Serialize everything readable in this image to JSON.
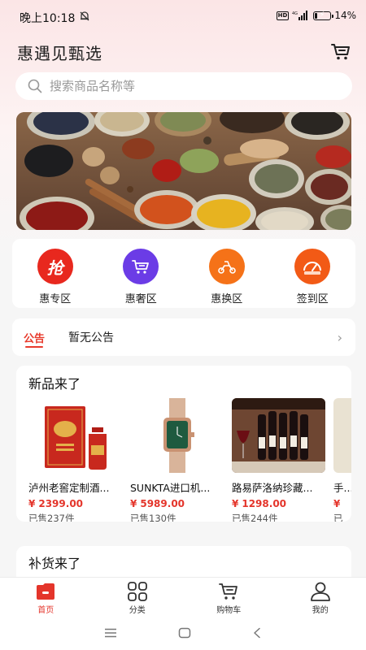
{
  "status_bar": {
    "time": "晚上10:18",
    "network": "4G",
    "hd": "HD",
    "battery_percent": "14%",
    "battery_level": 0.14
  },
  "header": {
    "title": "惠遇见甄选",
    "cart_icon": "cart-icon"
  },
  "search": {
    "placeholder": "搜索商品名称等",
    "value": ""
  },
  "banner": {
    "description_icon": "spices-banner-image"
  },
  "quick_nav": [
    {
      "label": "惠专区",
      "icon": "qiang-icon",
      "color": "#e8281e",
      "glyph": "抢"
    },
    {
      "label": "惠奢区",
      "icon": "cart-icon",
      "color": "#6b3ce6",
      "glyph": ""
    },
    {
      "label": "惠换区",
      "icon": "scooter-icon",
      "color": "#f57218",
      "glyph": ""
    },
    {
      "label": "签到区",
      "icon": "checkin-icon",
      "color": "#f25a16",
      "glyph": ""
    }
  ],
  "notice": {
    "tag": "公告",
    "text": "暂无公告"
  },
  "new_products": {
    "title": "新品来了",
    "items": [
      {
        "name": "泸州老窖定制酒...",
        "currency": "¥",
        "price": "2399.00",
        "sold": "已售237件"
      },
      {
        "name": "SUNKTA进口机...",
        "currency": "¥",
        "price": "5989.00",
        "sold": "已售130件"
      },
      {
        "name": "路易萨洛纳珍藏...",
        "currency": "¥",
        "price": "1298.00",
        "sold": "已售244件"
      },
      {
        "name": "手...",
        "currency": "¥",
        "price": "",
        "sold": "已"
      }
    ]
  },
  "restock": {
    "title": "补货来了"
  },
  "tab_bar": [
    {
      "label": "首页",
      "icon": "home-icon",
      "active": true
    },
    {
      "label": "分类",
      "icon": "grid-icon",
      "active": false
    },
    {
      "label": "购物车",
      "icon": "cart-icon",
      "active": false
    },
    {
      "label": "我的",
      "icon": "user-icon",
      "active": false
    }
  ],
  "colors": {
    "accent": "#e4352b",
    "background": "#f6f6f6"
  }
}
